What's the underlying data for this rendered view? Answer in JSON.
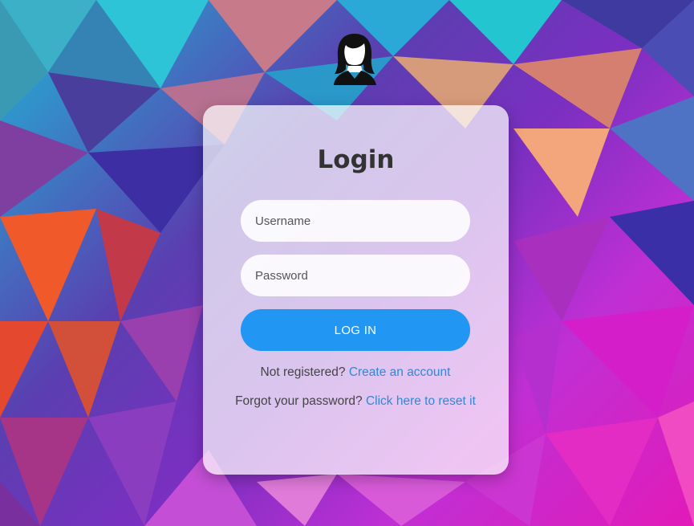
{
  "avatar": {
    "icon": "user-avatar-icon"
  },
  "login": {
    "title": "Login",
    "username_placeholder": "Username",
    "password_placeholder": "Password",
    "submit_label": "LOG IN",
    "register_prompt": "Not registered?",
    "register_link": "Create an account",
    "forgot_prompt": "Forgot your password?",
    "forgot_link": "Click here to reset it"
  },
  "colors": {
    "accent": "#2196f3",
    "link": "#2c8ad8",
    "title": "#333333"
  }
}
